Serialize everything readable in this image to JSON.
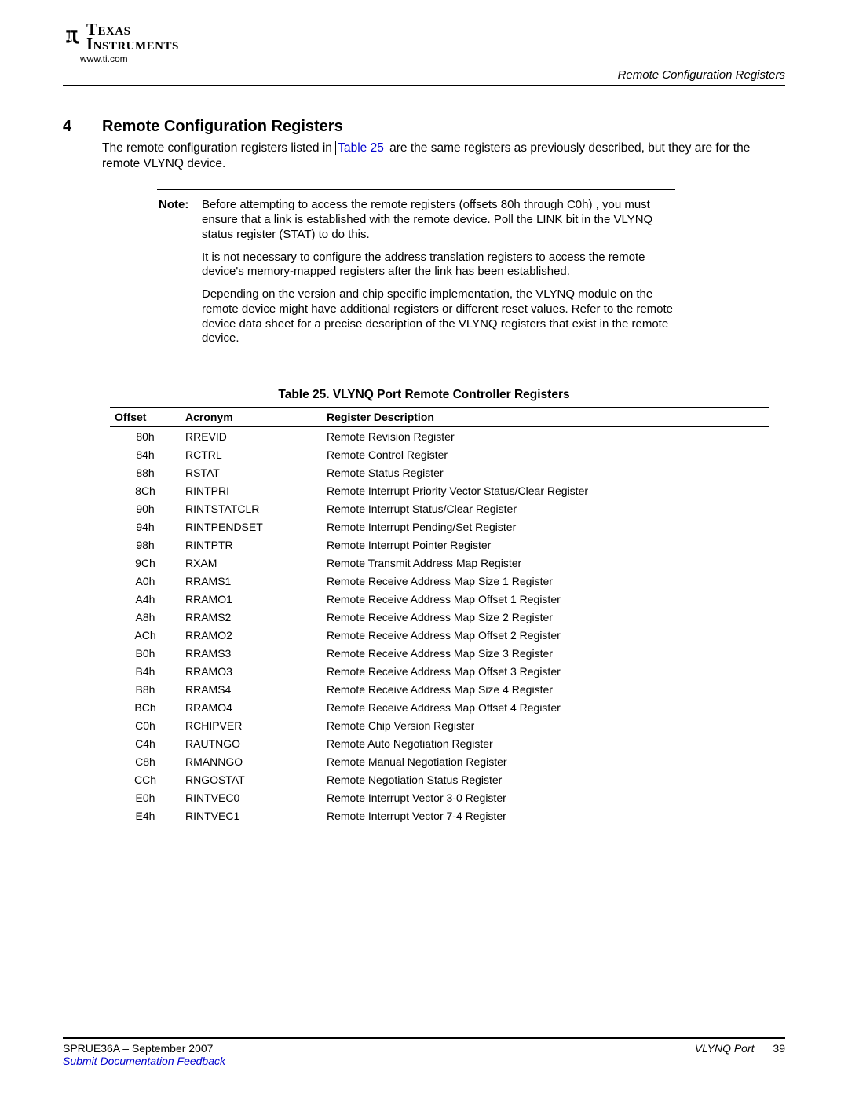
{
  "header": {
    "logo_line1": "Texas",
    "logo_line2": "Instruments",
    "url": "www.ti.com",
    "running_head": "Remote Configuration Registers"
  },
  "section": {
    "number": "4",
    "title": "Remote Configuration Registers",
    "intro_pre": "The remote configuration registers listed in ",
    "intro_link": "Table 25",
    "intro_post": " are the same registers as previously described, but they are for the remote VLYNQ device."
  },
  "note": {
    "label": "Note:",
    "p1": "Before attempting to access the remote registers (offsets 80h through C0h) , you must ensure that a link is established with the remote device. Poll the LINK bit in the VLYNQ status register (STAT) to do this.",
    "p2": "It is not necessary to configure the address translation registers to access the remote device's memory-mapped registers after the link has been established.",
    "p3": "Depending on the version and chip specific implementation, the VLYNQ module on the remote device might have additional registers or different reset values. Refer to the remote device data sheet for a precise description of the VLYNQ registers that exist in the remote device."
  },
  "table": {
    "caption": "Table 25. VLYNQ Port Remote Controller Registers",
    "cols": {
      "c0": "Offset",
      "c1": "Acronym",
      "c2": "Register Description"
    },
    "rows": [
      {
        "off": "80h",
        "acr": "RREVID",
        "desc": "Remote Revision Register"
      },
      {
        "off": "84h",
        "acr": "RCTRL",
        "desc": "Remote Control Register"
      },
      {
        "off": "88h",
        "acr": "RSTAT",
        "desc": "Remote Status Register"
      },
      {
        "off": "8Ch",
        "acr": "RINTPRI",
        "desc": "Remote Interrupt Priority Vector Status/Clear Register"
      },
      {
        "off": "90h",
        "acr": "RINTSTATCLR",
        "desc": "Remote Interrupt Status/Clear Register"
      },
      {
        "off": "94h",
        "acr": "RINTPENDSET",
        "desc": "Remote Interrupt Pending/Set Register"
      },
      {
        "off": "98h",
        "acr": "RINTPTR",
        "desc": "Remote Interrupt Pointer Register"
      },
      {
        "off": "9Ch",
        "acr": "RXAM",
        "desc": "Remote Transmit Address Map Register"
      },
      {
        "off": "A0h",
        "acr": "RRAMS1",
        "desc": "Remote Receive Address Map Size 1 Register"
      },
      {
        "off": "A4h",
        "acr": "RRAMO1",
        "desc": "Remote Receive Address Map Offset 1 Register"
      },
      {
        "off": "A8h",
        "acr": "RRAMS2",
        "desc": "Remote Receive Address Map Size 2 Register"
      },
      {
        "off": "ACh",
        "acr": "RRAMO2",
        "desc": "Remote Receive Address Map Offset 2 Register"
      },
      {
        "off": "B0h",
        "acr": "RRAMS3",
        "desc": "Remote Receive Address Map Size 3 Register"
      },
      {
        "off": "B4h",
        "acr": "RRAMO3",
        "desc": "Remote Receive Address Map Offset 3 Register"
      },
      {
        "off": "B8h",
        "acr": "RRAMS4",
        "desc": "Remote Receive Address Map Size 4 Register"
      },
      {
        "off": "BCh",
        "acr": "RRAMO4",
        "desc": "Remote Receive Address Map Offset 4 Register"
      },
      {
        "off": "C0h",
        "acr": "RCHIPVER",
        "desc": "Remote Chip Version Register"
      },
      {
        "off": "C4h",
        "acr": "RAUTNGO",
        "desc": "Remote Auto Negotiation Register"
      },
      {
        "off": "C8h",
        "acr": "RMANNGO",
        "desc": "Remote Manual Negotiation Register"
      },
      {
        "off": "CCh",
        "acr": "RNGOSTAT",
        "desc": "Remote Negotiation Status Register"
      },
      {
        "off": "E0h",
        "acr": "RINTVEC0",
        "desc": "Remote Interrupt Vector 3-0 Register"
      },
      {
        "off": "E4h",
        "acr": "RINTVEC1",
        "desc": "Remote Interrupt Vector 7-4 Register"
      }
    ]
  },
  "footer": {
    "docid": "SPRUE36A – September 2007",
    "doctitle": "VLYNQ Port",
    "page": "39",
    "feedback": "Submit Documentation Feedback"
  }
}
